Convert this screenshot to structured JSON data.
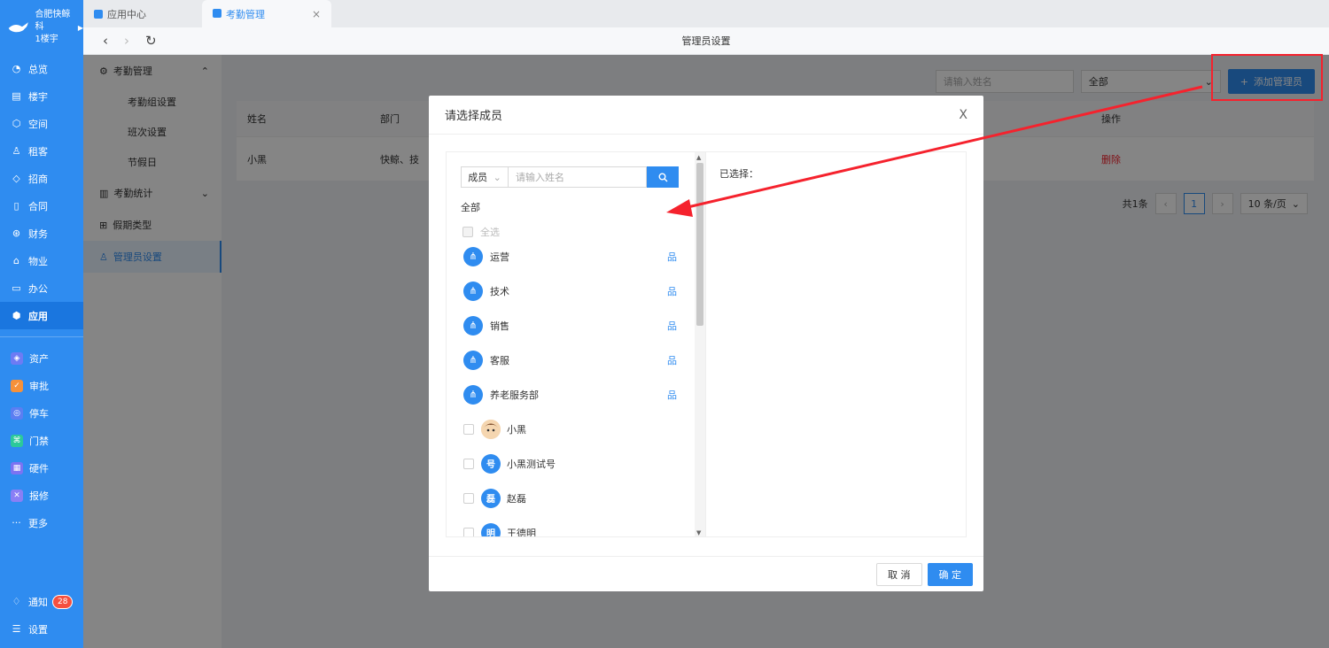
{
  "org": {
    "name": "合肥快鲸科",
    "building": "1楼宇"
  },
  "sidebar": {
    "nav": [
      {
        "label": "总览",
        "icon": "dashboard-icon"
      },
      {
        "label": "楼宇",
        "icon": "building-icon"
      },
      {
        "label": "空间",
        "icon": "cube-icon"
      },
      {
        "label": "租客",
        "icon": "users-icon"
      },
      {
        "label": "招商",
        "icon": "tag-icon"
      },
      {
        "label": "合同",
        "icon": "document-icon"
      },
      {
        "label": "财务",
        "icon": "finance-icon"
      },
      {
        "label": "物业",
        "icon": "home-icon"
      },
      {
        "label": "办公",
        "icon": "monitor-icon"
      },
      {
        "label": "应用",
        "icon": "app-icon"
      }
    ],
    "apps": [
      {
        "label": "资产",
        "icon": "asset-icon",
        "color": "#6d7bf4"
      },
      {
        "label": "审批",
        "icon": "approval-icon",
        "color": "#f5913a"
      },
      {
        "label": "停车",
        "icon": "parking-icon",
        "color": "#5b7ef2"
      },
      {
        "label": "门禁",
        "icon": "door-icon",
        "color": "#2cc99a"
      },
      {
        "label": "硬件",
        "icon": "hardware-icon",
        "color": "#7b73f2"
      },
      {
        "label": "报修",
        "icon": "repair-icon",
        "color": "#8a7ff5"
      }
    ],
    "more": "更多",
    "notify": "通知",
    "notify_count": "28",
    "settings": "设置"
  },
  "tabs": [
    {
      "label": "应用中心"
    },
    {
      "label": "考勤管理"
    }
  ],
  "page_title": "管理员设置",
  "submenu": {
    "group1": "考勤管理",
    "sub1": "考勤组设置",
    "sub2": "班次设置",
    "sub3": "节假日",
    "group2": "考勤统计",
    "group3": "假期类型",
    "group4": "管理员设置"
  },
  "main": {
    "search_placeholder": "请输入姓名",
    "filter_value": "全部",
    "add_button": "添加管理员",
    "columns": [
      "姓名",
      "部门",
      "操作"
    ],
    "rows": [
      {
        "name": "小黑",
        "dept": "快鲸、技",
        "action": "删除"
      }
    ],
    "pager": {
      "total": "共1条",
      "page": "1",
      "size": "10 条/页"
    }
  },
  "modal": {
    "title": "请选择成员",
    "search_type": "成员",
    "search_placeholder": "请输入姓名",
    "all_label": "全部",
    "select_all": "全选",
    "depts": [
      "运营",
      "技术",
      "销售",
      "客服",
      "养老服务部"
    ],
    "people": [
      {
        "name": "小黑",
        "avatar": ""
      },
      {
        "name": "小黑测试号",
        "avatar": "号"
      },
      {
        "name": "赵磊",
        "avatar": "磊"
      },
      {
        "name": "王德明",
        "avatar": "明"
      }
    ],
    "selected_label": "已选择：",
    "cancel": "取 消",
    "confirm": "确 定"
  },
  "colors": {
    "accent": "#2f8cf0",
    "annotation": "#f5222d"
  }
}
